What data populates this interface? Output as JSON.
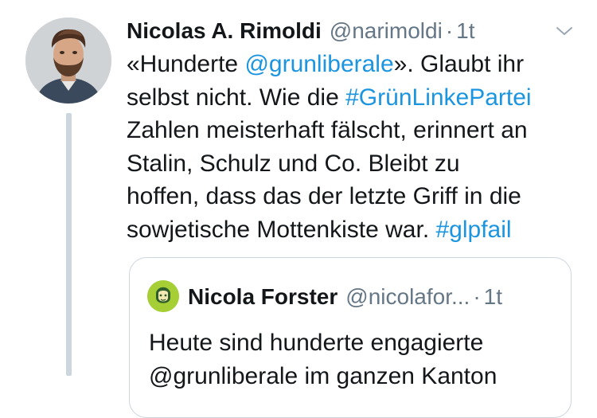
{
  "tweet": {
    "author_name": "Nicolas A. Rimoldi",
    "author_handle": "@narimoldi",
    "separator": "·",
    "time": "1t",
    "menu_icon": "chevron-down-icon",
    "lines": [
      [
        {
          "text": "«Hunderte "
        },
        {
          "text": "@grunliberale",
          "link": true
        },
        {
          "text": "». Glaubt ihr"
        }
      ],
      [
        {
          "text": "selbst nicht. Wie die "
        },
        {
          "text": "#GrünLinkePartei",
          "link": true
        }
      ],
      [
        {
          "text": "Zahlen meisterhaft fälscht, erinnert an"
        }
      ],
      [
        {
          "text": "Stalin, Schulz und Co. Bleibt zu"
        }
      ],
      [
        {
          "text": "hoffen, dass das der letzte Griff in die"
        }
      ],
      [
        {
          "text": "sowjetische Mottenkiste war. "
        },
        {
          "text": "#glpfail",
          "link": true
        }
      ]
    ]
  },
  "quoted_tweet": {
    "author_name": "Nicola Forster",
    "author_handle": "@nicolafor...",
    "separator": "·",
    "time": "1t",
    "lines": [
      "Heute sind hunderte engagierte",
      "@grunliberale im ganzen Kanton"
    ]
  },
  "colors": {
    "link": "#1b95e0",
    "secondary_text": "#657786",
    "border": "#ccd6dd"
  }
}
